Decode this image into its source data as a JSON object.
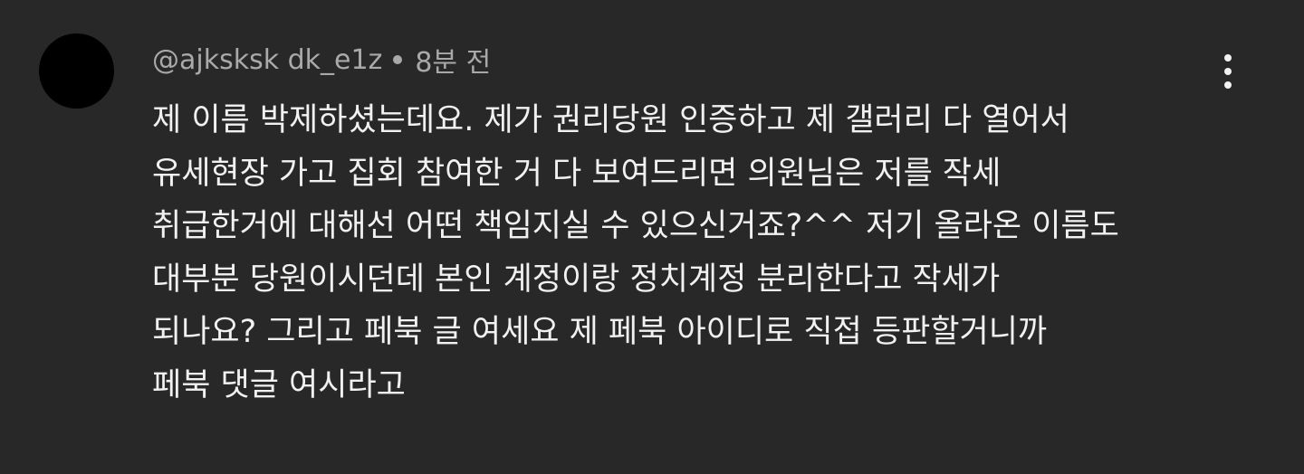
{
  "comment": {
    "author": "@ajksksk dk_e1z",
    "time": "8분 전",
    "menu_icon": "more-vert-icon",
    "lines": [
      "제 이름 박제하셨는데요. 제가 권리당원 인증하고 제 갤러리 다 열어서",
      "유세현장 가고 집회 참여한 거 다 보여드리면 의원님은 저를 작세",
      "취급한거에 대해선 어떤 책임지실 수 있으신거죠?^^ 저기 올라온 이름도",
      "대부분 당원이시던데 본인 계정이랑 정치계정 분리한다고 작세가",
      "되나요? 그리고 페북 글 여세요 제 페북 아이디로 직접 등판할거니까",
      "페북 댓글 여시라고"
    ]
  },
  "colors": {
    "background": "#282828",
    "text": "#f1f1f1",
    "meta": "#a9a9a9",
    "avatar": "#000000"
  }
}
